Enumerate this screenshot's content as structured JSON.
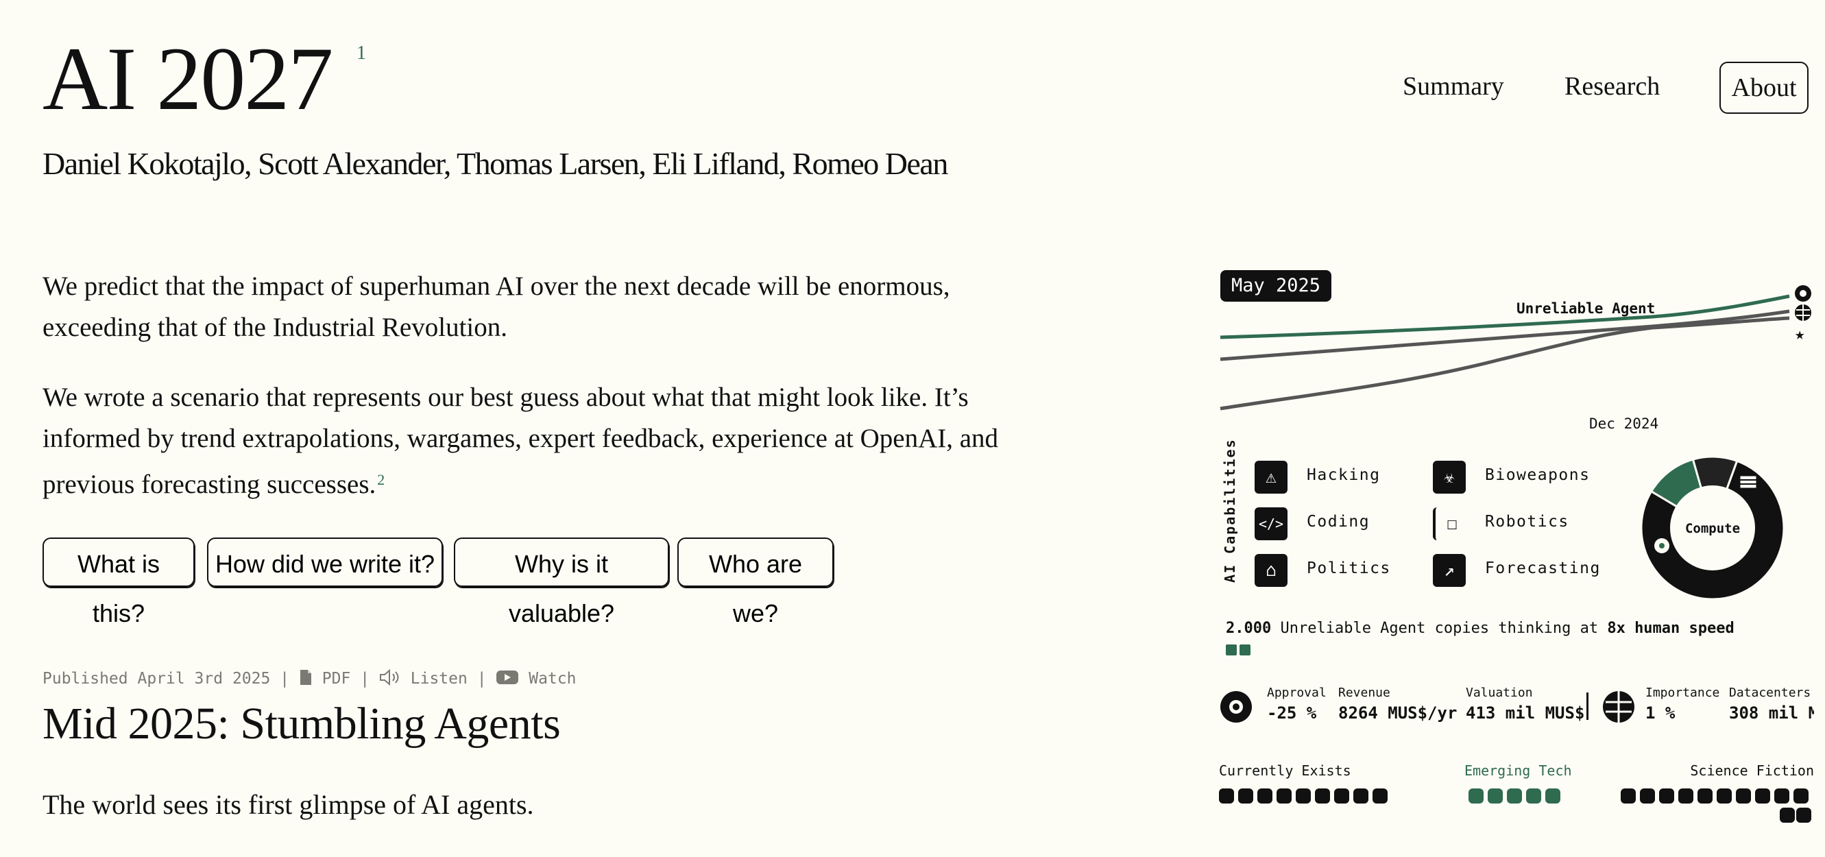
{
  "header": {
    "title": "AI 2027",
    "title_footnote": "1",
    "authors": "Daniel Kokotajlo, Scott Alexander, Thomas Larsen, Eli Lifland, Romeo Dean"
  },
  "nav": {
    "items": [
      "Summary",
      "Research",
      "About"
    ],
    "active": "About"
  },
  "intro": {
    "p1": "We predict that the impact of superhuman AI over the next decade will be enormous, exceeding that of the Industrial Revolution.",
    "p2": "We wrote a scenario that represents our best guess about what that might look like. It’s informed by trend extrapolations, wargames, expert feedback, experience at OpenAI, and previous forecasting successes.",
    "p2_footnote": "2"
  },
  "faq_buttons": [
    "What is this?",
    "How did we write it?",
    "Why is it valuable?",
    "Who are we?"
  ],
  "published": {
    "date_text": "Published April 3rd 2025",
    "sep": "|",
    "pdf": "PDF",
    "listen": "Listen",
    "watch": "Watch"
  },
  "section": {
    "heading": "Mid 2025: Stumbling Agents",
    "lede": "The world sees its first glimpse of AI agents."
  },
  "dashboard": {
    "date": "May 2025",
    "trend_label": "Unreliable Agent",
    "axis_label": "Dec 2024",
    "capabilities_header": "AI Capabilities",
    "capabilities": [
      {
        "label": "Hacking",
        "icon": "shield-alert-icon"
      },
      {
        "label": "Coding",
        "icon": "code-icon"
      },
      {
        "label": "Politics",
        "icon": "capitol-icon"
      },
      {
        "label": "Bioweapons",
        "icon": "biohazard-icon"
      },
      {
        "label": "Robotics",
        "icon": "robot-icon"
      },
      {
        "label": "Forecasting",
        "icon": "trend-chart-icon"
      }
    ],
    "compute_label": "Compute",
    "compute_share": {
      "black": 0.78,
      "green": 0.12,
      "dark": 0.1
    },
    "agents": {
      "count": "2.000",
      "text": "Unreliable Agent copies thinking at",
      "speed": "8x human speed"
    },
    "metrics_left": [
      {
        "label": "Approval",
        "value": "-25 %"
      },
      {
        "label": "Revenue",
        "value": "8264 MUS$/yr"
      },
      {
        "label": "Valuation",
        "value": "413 mil MUS$"
      }
    ],
    "metrics_right": [
      {
        "label": "Importance",
        "value": "1 %"
      },
      {
        "label": "Datacenters",
        "value": "308 mil M"
      }
    ],
    "tech": {
      "current_label": "Currently Exists",
      "emerging_label": "Emerging Tech",
      "scifi_label": "Science Fiction"
    },
    "colors": {
      "green": "#2f6b4f",
      "gray": "#555555",
      "ink": "#111111",
      "bg": "#fdfdf6"
    }
  }
}
